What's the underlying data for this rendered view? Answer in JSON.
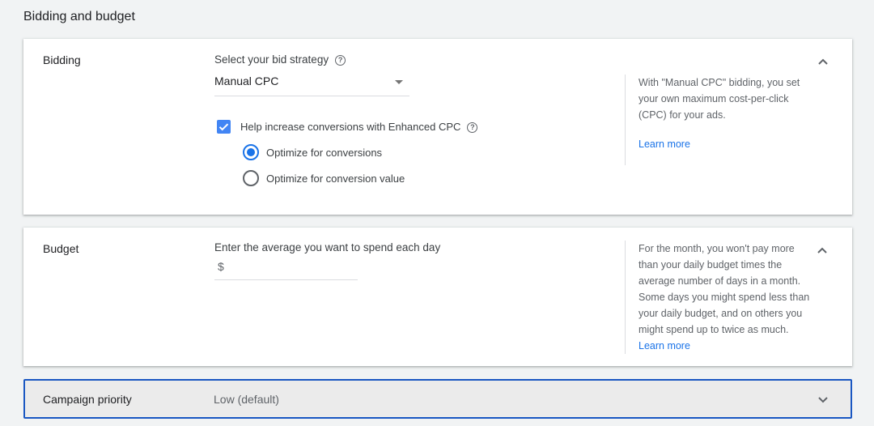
{
  "section_title": "Bidding and budget",
  "bidding": {
    "label": "Bidding",
    "strategy_label": "Select your bid strategy",
    "strategy_value": "Manual CPC",
    "ecpc_label": "Help increase conversions with Enhanced CPC",
    "ecpc_checked": true,
    "options": [
      {
        "label": "Optimize for conversions",
        "selected": true
      },
      {
        "label": "Optimize for conversion value",
        "selected": false
      }
    ],
    "help_text": "With \"Manual CPC\" bidding, you set your own maximum cost-per-click (CPC) for your ads.",
    "learn_more": "Learn more"
  },
  "budget": {
    "label": "Budget",
    "prompt": "Enter the average you want to spend each day",
    "currency": "$",
    "value": "",
    "help_text": "For the month, you won't pay more than your daily budget times the average number of days in a month. Some days you might spend less than your daily budget, and on others you might spend up to twice as much.",
    "learn_more": "Learn more"
  },
  "priority": {
    "label": "Campaign priority",
    "value": "Low (default)"
  },
  "colors": {
    "accent": "#1a73e8",
    "focus_border": "#1a57c2"
  }
}
